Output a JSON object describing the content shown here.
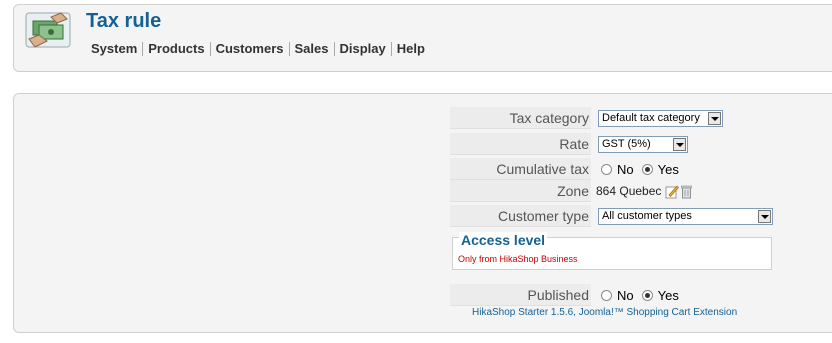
{
  "header": {
    "title": "Tax rule",
    "menu": [
      "System",
      "Products",
      "Customers",
      "Sales",
      "Display",
      "Help"
    ]
  },
  "form": {
    "tax_category": {
      "label": "Tax category",
      "value": "Default tax category"
    },
    "rate": {
      "label": "Rate",
      "value": "GST (5%)"
    },
    "cumulative_tax": {
      "label": "Cumulative tax",
      "no": "No",
      "yes": "Yes",
      "selected": "Yes"
    },
    "zone": {
      "label": "Zone",
      "value": "864 Quebec"
    },
    "customer_type": {
      "label": "Customer type",
      "value": "All customer types"
    },
    "access_level": {
      "legend": "Access level",
      "note": "Only from HikaShop Business"
    },
    "published": {
      "label": "Published",
      "no": "No",
      "yes": "Yes",
      "selected": "Yes"
    }
  },
  "footer": {
    "text": "HikaShop Starter 1.5.6, Joomla!™ Shopping Cart Extension"
  },
  "colors": {
    "accent": "#146295",
    "note_red": "#cc0000",
    "panel_bg": "#f4f4f4"
  }
}
